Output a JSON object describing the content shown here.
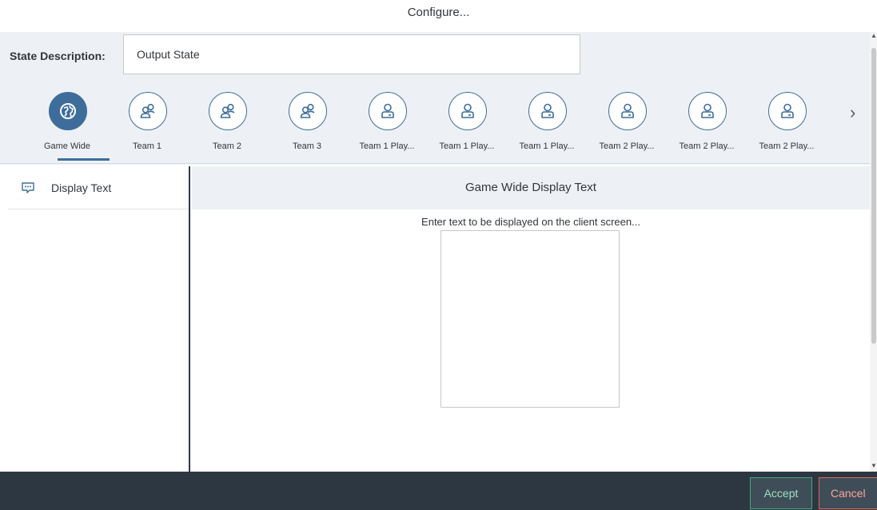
{
  "dialog": {
    "title": "Configure..."
  },
  "state": {
    "label": "State Description:",
    "value": "Output State"
  },
  "tabs": [
    {
      "label": "Game Wide",
      "icon": "globe-icon",
      "selected": true
    },
    {
      "label": "Team 1",
      "icon": "group-icon"
    },
    {
      "label": "Team 2",
      "icon": "group-icon"
    },
    {
      "label": "Team 3",
      "icon": "group-icon"
    },
    {
      "label": "Team 1 Play...",
      "icon": "user-icon"
    },
    {
      "label": "Team 1 Play...",
      "icon": "user-icon"
    },
    {
      "label": "Team 1 Play...",
      "icon": "user-icon"
    },
    {
      "label": "Team 2 Play...",
      "icon": "user-icon"
    },
    {
      "label": "Team 2 Play...",
      "icon": "user-icon"
    },
    {
      "label": "Team 2 Play...",
      "icon": "user-icon"
    }
  ],
  "nav": {
    "items": [
      {
        "label": "Display Text",
        "icon": "speech-bubble-icon"
      }
    ]
  },
  "content": {
    "header": "Game Wide Display Text",
    "prompt": "Enter text to be displayed on the client screen...",
    "text_value": ""
  },
  "footer": {
    "accept_label": "Accept",
    "cancel_label": "Cancel"
  },
  "colors": {
    "accent": "#3e6d9c",
    "panel": "#edf1f5",
    "footer": "#2d3742",
    "accept": "#3fa87a",
    "cancel": "#d9675b"
  }
}
